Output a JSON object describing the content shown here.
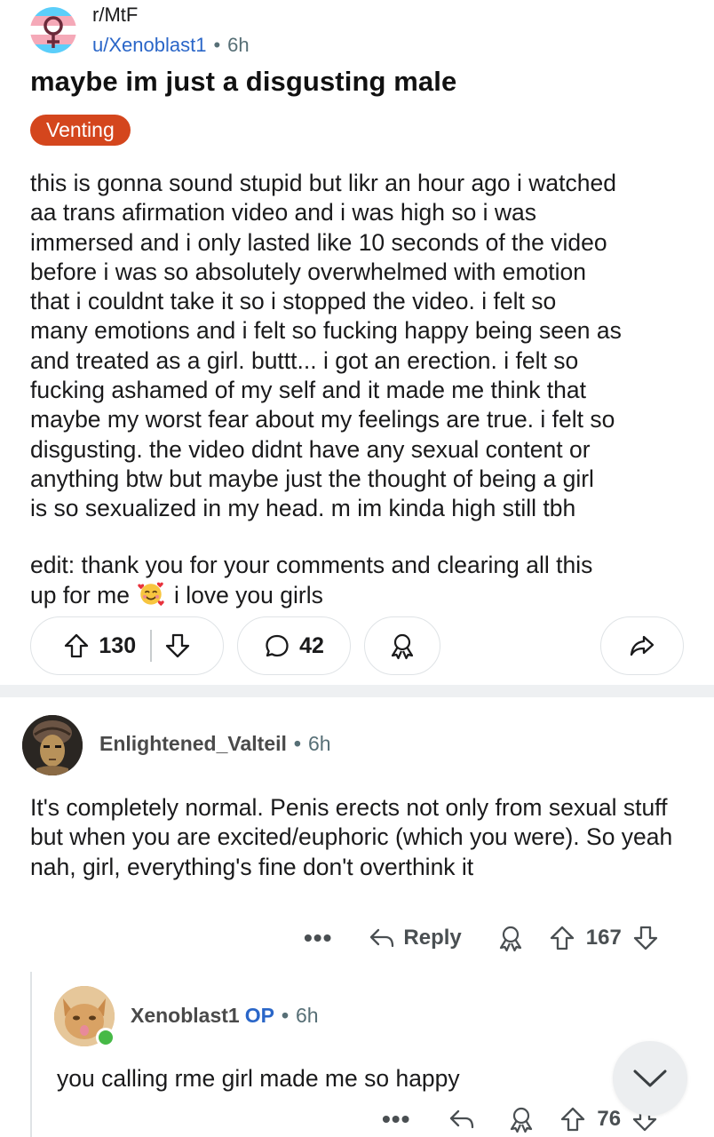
{
  "post": {
    "subreddit": "r/MtF",
    "author": "u/Xenoblast1",
    "separator": "•",
    "time": "6h",
    "title": "maybe im just a disgusting male",
    "flair": "Venting",
    "body": "this is gonna sound stupid but likr an hour ago i watched\naa trans afirmation video and i was high so i was\nimmersed and i only lasted like 10 seconds of the video\nbefore i was so absolutely overwhelmed with emotion\nthat i couldnt take it so i stopped the video. i felt so\nmany emotions and i felt so fucking happy being seen as\nand treated as a girl. buttt... i got an erection. i felt so\nfucking ashamed of my self and it made me think that\nmaybe my worst fear about my feelings are true. i felt so\ndisgusting. the video didnt have any sexual content or\nanything btw but maybe just the thought of being a girl\nis so sexualized in my head. m im kinda high still tbh",
    "edit_line1": "edit: thank you for your comments and clearing all this",
    "edit_line2_pre": "up for me",
    "edit_line2_post": "i love you girls",
    "upvotes": "130",
    "comments": "42"
  },
  "comments": [
    {
      "author": "Enlightened_Valteil",
      "separator": "•",
      "time": "6h",
      "body": "It's completely normal. Penis erects not only from sexual stuff but when you are excited/euphoric (which you were). So yeah nah, girl, everything's fine don't overthink it",
      "more": "•••",
      "reply_label": "Reply",
      "score": "167"
    },
    {
      "author": "Xenoblast1",
      "op_tag": "OP",
      "separator": "•",
      "time": "6h",
      "body": "you calling rme girl made me so happy",
      "more": "•••",
      "score": "76"
    }
  ],
  "colors": {
    "flair_bg": "#d4461d",
    "link_blue": "#2a66c8",
    "online_green": "#46b946",
    "divider": "#eef0f2"
  },
  "icons": [
    "trans-flag-avatar-icon",
    "upvote-icon",
    "downvote-icon",
    "comment-bubble-icon",
    "award-icon",
    "share-icon",
    "reply-arrow-icon",
    "chevron-down-icon"
  ]
}
